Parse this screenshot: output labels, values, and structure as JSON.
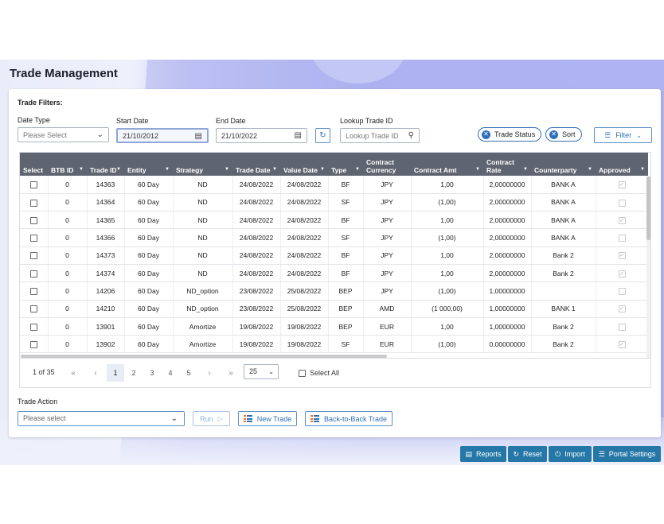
{
  "page": {
    "title": "Trade Management"
  },
  "filters": {
    "heading": "Trade Filters:",
    "date_type": {
      "label": "Date Type",
      "placeholder": "Please Select"
    },
    "start_date": {
      "label": "Start Date",
      "value": "21/10/2012"
    },
    "end_date": {
      "label": "End Date",
      "value": "21/10/2022"
    },
    "lookup": {
      "label": "Lookup Trade ID",
      "placeholder": "Lookup Trade ID"
    },
    "chips": [
      "Trade Status",
      "Sort"
    ],
    "filter_button": "Filter"
  },
  "table": {
    "columns": [
      "Select",
      "BTB ID",
      "Trade ID",
      "Entity",
      "Strategy",
      "Trade Date",
      "Value Date",
      "Type",
      "Contract Currency",
      "Contract Amt",
      "Contract Rate",
      "Counterparty",
      "Approved"
    ],
    "rows": [
      {
        "btb": "0",
        "id": "14363",
        "entity": "60 Day",
        "strategy": "ND",
        "trade_date": "24/08/2022",
        "value_date": "24/08/2022",
        "type": "BF",
        "ccy": "JPY",
        "amt": "1,00",
        "rate": "2,00000000",
        "cpty": "BANK A",
        "approved": true
      },
      {
        "btb": "0",
        "id": "14364",
        "entity": "60 Day",
        "strategy": "ND",
        "trade_date": "24/08/2022",
        "value_date": "24/08/2022",
        "type": "SF",
        "ccy": "JPY",
        "amt": "(1,00)",
        "rate": "2,00000000",
        "cpty": "BANK A",
        "approved": false
      },
      {
        "btb": "0",
        "id": "14365",
        "entity": "60 Day",
        "strategy": "ND",
        "trade_date": "24/08/2022",
        "value_date": "24/08/2022",
        "type": "BF",
        "ccy": "JPY",
        "amt": "1,00",
        "rate": "2,00000000",
        "cpty": "BANK A",
        "approved": true
      },
      {
        "btb": "0",
        "id": "14366",
        "entity": "60 Day",
        "strategy": "ND",
        "trade_date": "24/08/2022",
        "value_date": "24/08/2022",
        "type": "SF",
        "ccy": "JPY",
        "amt": "(1,00)",
        "rate": "2,00000000",
        "cpty": "BANK A",
        "approved": false
      },
      {
        "btb": "0",
        "id": "14373",
        "entity": "60 Day",
        "strategy": "ND",
        "trade_date": "24/08/2022",
        "value_date": "24/08/2022",
        "type": "BF",
        "ccy": "JPY",
        "amt": "1,00",
        "rate": "2,00000000",
        "cpty": "Bank 2",
        "approved": true
      },
      {
        "btb": "0",
        "id": "14374",
        "entity": "60 Day",
        "strategy": "ND",
        "trade_date": "24/08/2022",
        "value_date": "24/08/2022",
        "type": "BF",
        "ccy": "JPY",
        "amt": "1,00",
        "rate": "2,00000000",
        "cpty": "Bank 2",
        "approved": true
      },
      {
        "btb": "0",
        "id": "14206",
        "entity": "60 Day",
        "strategy": "ND_option",
        "trade_date": "23/08/2022",
        "value_date": "25/08/2022",
        "type": "BEP",
        "ccy": "JPY",
        "amt": "(1,00)",
        "rate": "1,00000000",
        "cpty": "",
        "approved": false
      },
      {
        "btb": "0",
        "id": "14210",
        "entity": "60 Day",
        "strategy": "ND_option",
        "trade_date": "23/08/2022",
        "value_date": "25/08/2022",
        "type": "BEP",
        "ccy": "AMD",
        "amt": "(1 000,00)",
        "rate": "1,00000000",
        "cpty": "BANK 1",
        "approved": true
      },
      {
        "btb": "0",
        "id": "13901",
        "entity": "60 Day",
        "strategy": "Amortize",
        "trade_date": "19/08/2022",
        "value_date": "19/08/2022",
        "type": "BEP",
        "ccy": "EUR",
        "amt": "1,00",
        "rate": "1,00000000",
        "cpty": "Bank 2",
        "approved": false
      },
      {
        "btb": "0",
        "id": "13902",
        "entity": "60 Day",
        "strategy": "Amortize",
        "trade_date": "19/08/2022",
        "value_date": "19/08/2022",
        "type": "SF",
        "ccy": "EUR",
        "amt": "(1,00)",
        "rate": "0,00000000",
        "cpty": "Bank 2",
        "approved": true
      }
    ]
  },
  "pager": {
    "info": "1 of 35",
    "pages": [
      "1",
      "2",
      "3",
      "4",
      "5"
    ],
    "page_size": "25",
    "select_all": "Select All"
  },
  "actions": {
    "label": "Trade Action",
    "placeholder": "Please select",
    "run": "Run",
    "new_trade": "New Trade",
    "btb_trade": "Back-to-Back Trade"
  },
  "toolbar": {
    "reports": "Reports",
    "reset": "Reset",
    "import": "Import",
    "portal_settings": "Portal Settings"
  },
  "colors": {
    "primary": "#2577a8",
    "header": "#5f6570",
    "accent": "#2f6fb8"
  }
}
